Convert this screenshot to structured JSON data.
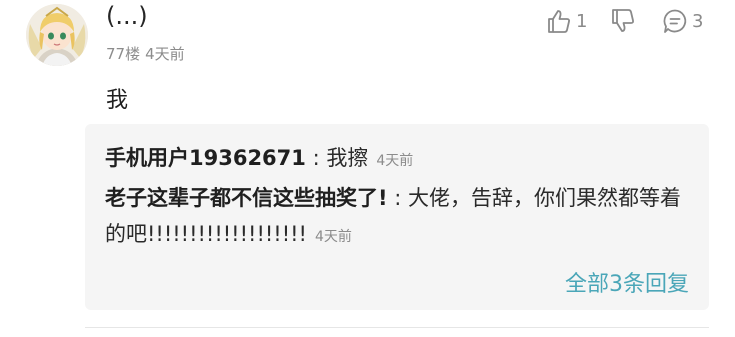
{
  "comment": {
    "username": "(...)",
    "floor": "77楼",
    "time": "4天前",
    "body": "我",
    "actions": {
      "like_icon": "thumbs-up-icon",
      "like_count": "1",
      "dislike_icon": "thumbs-down-icon",
      "reply_icon": "comment-bubble-icon",
      "reply_count": "3"
    }
  },
  "replies": [
    {
      "name": "手机用户19362671",
      "separator": " : ",
      "text": "我擦",
      "time": "4天前"
    },
    {
      "name": "老子这辈子都不信这些抽奖了!",
      "separator": " : ",
      "text": "大佬，告辞，你们果然都等着的吧!!!!!!!!!!!!!!!!!!!",
      "time": "4天前"
    }
  ],
  "more_replies": "全部3条回复",
  "colors": {
    "accent": "#4aa6b8",
    "reply_bg": "#f5f5f5",
    "muted": "#8c8c8c"
  }
}
